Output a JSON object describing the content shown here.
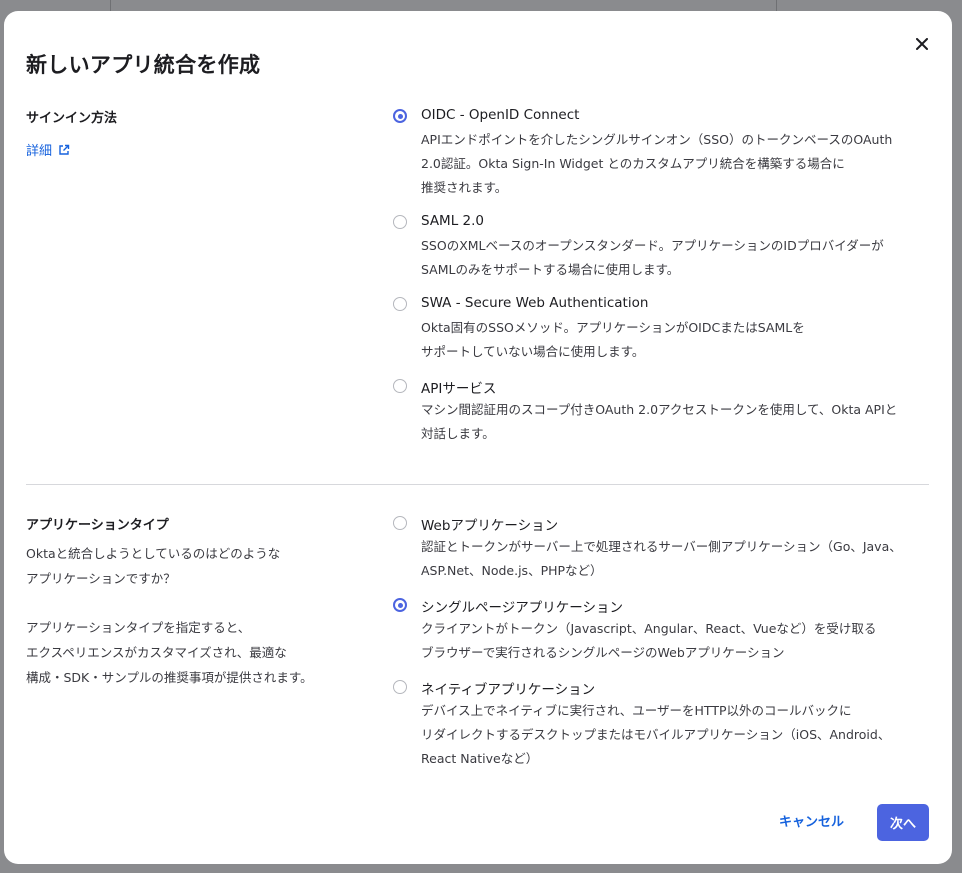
{
  "dialog": {
    "title": "新しいアプリ統合を作成",
    "close_icon": "close-icon"
  },
  "sign_in": {
    "label": "サインイン方法",
    "learn_more": "詳細",
    "learn_more_icon": "external-link-icon",
    "options": [
      {
        "label": "OIDC - OpenID Connect",
        "selected": true,
        "desc": [
          "APIエンドポイントを介したシングルサインオン（SSO）のトークンベースのOAuth",
          "2.0認証。Okta Sign-In Widget とのカスタムアプリ統合を構築する場合に",
          "推奨されます。"
        ]
      },
      {
        "label": "SAML 2.0",
        "selected": false,
        "desc": [
          "SSOのXMLベースのオープンスタンダード。アプリケーションのIDプロバイダーが",
          "SAMLのみをサポートする場合に使用します。"
        ]
      },
      {
        "label": "SWA - Secure Web Authentication",
        "selected": false,
        "desc": [
          "Okta固有のSSOメソッド。アプリケーションがOIDCまたはSAMLを",
          "サポートしていない場合に使用します。"
        ]
      },
      {
        "label": "APIサービス",
        "selected": false,
        "desc": [
          "マシン間認証用のスコープ付きOAuth 2.0アクセストークンを使用して、Okta APIと",
          "対話します。"
        ]
      }
    ]
  },
  "app_type": {
    "label": "アプリケーションタイプ",
    "question": [
      "Oktaと統合しようとしているのはどのような",
      "アプリケーションですか？"
    ],
    "hint": [
      "アプリケーションタイプを指定すると、",
      "エクスペリエンスがカスタマイズされ、最適な",
      "構成・SDK・サンプルの推奨事項が提供されます。"
    ],
    "options": [
      {
        "label": "Webアプリケーション",
        "selected": false,
        "desc": [
          "認証とトークンがサーバー上で処理されるサーバー側アプリケーション（Go、Java、",
          "ASP.Net、Node.js、PHPなど）"
        ]
      },
      {
        "label": "シングルページアプリケーション",
        "selected": true,
        "desc": [
          "クライアントがトークン（Javascript、Angular、React、Vueなど）を受け取る",
          "ブラウザーで実行されるシングルページのWebアプリケーション"
        ]
      },
      {
        "label": "ネイティブアプリケーション",
        "selected": false,
        "desc": [
          "デバイス上でネイティブに実行され、ユーザーをHTTP以外のコールバックに",
          "リダイレクトするデスクトップまたはモバイルアプリケーション（iOS、Android、",
          "React Nativeなど）"
        ]
      }
    ]
  },
  "footer": {
    "cancel_label": "キャンセル",
    "next_label": "次へ"
  },
  "colors": {
    "accent": "#4c64e0",
    "link": "#1662dd"
  }
}
